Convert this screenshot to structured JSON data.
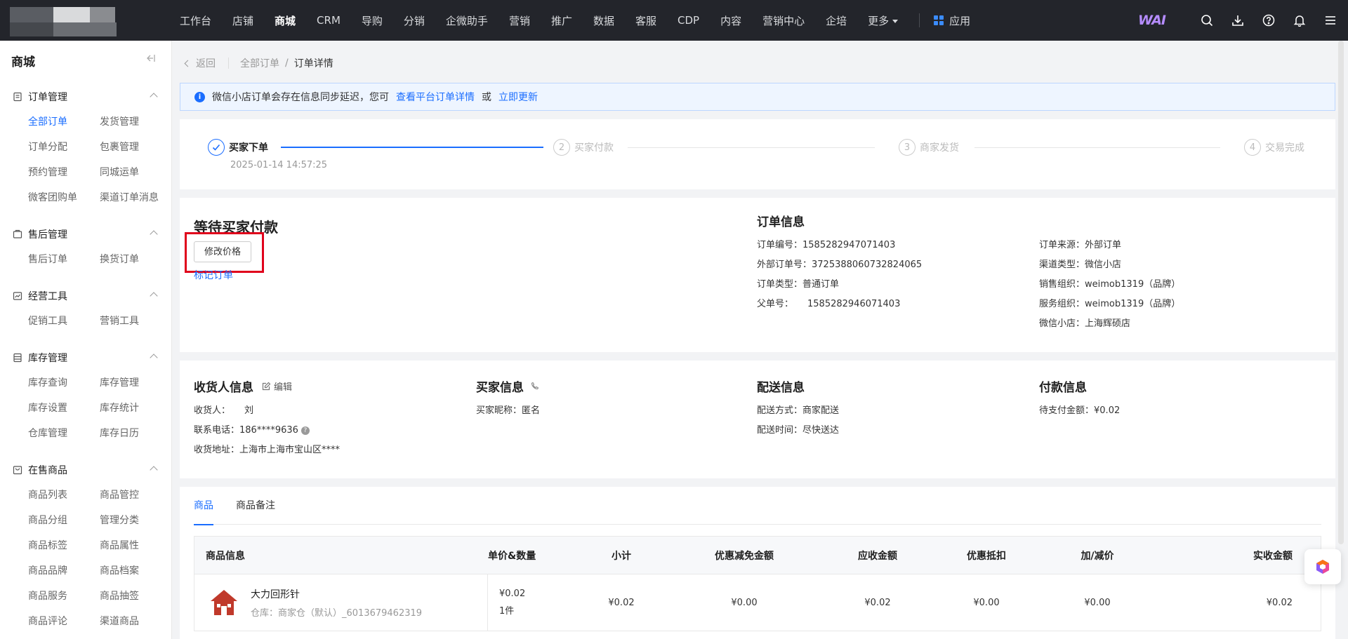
{
  "topbar": {
    "nav": [
      "工作台",
      "店铺",
      "商城",
      "CRM",
      "导购",
      "分销",
      "企微助手",
      "营销",
      "推广",
      "数据",
      "客服",
      "CDP",
      "内容",
      "营销中心",
      "企培"
    ],
    "active": "商城",
    "more": "更多",
    "app": "应用",
    "wai": "WAI",
    "icons": [
      "search-icon",
      "download-icon",
      "help-icon",
      "bell-icon",
      "menu-icon"
    ]
  },
  "sidebar": {
    "title": "商城",
    "groups": [
      {
        "label": "订单管理",
        "icon": "order-icon",
        "items": [
          "全部订单",
          "发货管理",
          "订单分配",
          "包裹管理",
          "预约管理",
          "同城运单",
          "微客团购单",
          "渠道订单消息"
        ]
      },
      {
        "label": "售后管理",
        "icon": "aftersale-icon",
        "items": [
          "售后订单",
          "换货订单"
        ]
      },
      {
        "label": "经营工具",
        "icon": "chart-icon",
        "items": [
          "促销工具",
          "营销工具"
        ]
      },
      {
        "label": "库存管理",
        "icon": "stock-icon",
        "items": [
          "库存查询",
          "库存管理",
          "库存设置",
          "库存统计",
          "仓库管理",
          "库存日历"
        ]
      },
      {
        "label": "在售商品",
        "icon": "goods-icon",
        "items": [
          "商品列表",
          "商品管控",
          "商品分组",
          "管理分类",
          "商品标签",
          "商品属性",
          "商品品牌",
          "商品档案",
          "商品服务",
          "商品抽签",
          "商品评论",
          "渠道商品"
        ]
      }
    ],
    "active_item": "全部订单"
  },
  "breadcrumb": {
    "back": "返回",
    "parent": "全部订单",
    "current": "订单详情"
  },
  "notice": {
    "text": "微信小店订单会存在信息同步延迟，您可",
    "link1": "查看平台订单详情",
    "or": "或",
    "link2": "立即更新"
  },
  "steps": [
    {
      "num": "1",
      "label": "买家下单",
      "done": true
    },
    {
      "num": "2",
      "label": "买家付款",
      "done": false
    },
    {
      "num": "3",
      "label": "商家发货",
      "done": false
    },
    {
      "num": "4",
      "label": "交易完成",
      "done": false
    }
  ],
  "step_time": "2025-01-14 14:57:25",
  "status": {
    "title": "等待买家付款",
    "modify_price": "修改价格",
    "mark_order": "标记订单"
  },
  "order_info": {
    "title": "订单信息",
    "left": [
      {
        "k": "订单编号：",
        "v": "1585282947071403"
      },
      {
        "k": "外部订单号：",
        "v": "3725388060732824065"
      },
      {
        "k": "订单类型：",
        "v": "普通订单"
      },
      {
        "k": "父单号：",
        "v": "1585282946071403"
      }
    ],
    "right": [
      {
        "k": "订单来源：",
        "v": "外部订单"
      },
      {
        "k": "渠道类型：",
        "v": "微信小店"
      },
      {
        "k": "销售组织：",
        "v": "weimob1319（品牌）"
      },
      {
        "k": "服务组织：",
        "v": "weimob1319（品牌）"
      },
      {
        "k": "微信小店：",
        "v": "上海辉硕店"
      }
    ]
  },
  "receiver": {
    "title": "收货人信息",
    "edit": "编辑",
    "name_k": "收货人：",
    "name_v": "刘",
    "phone_k": "联系电话：",
    "phone_v": "186****9636",
    "addr_k": "收货地址：",
    "addr_v": "上海市上海市宝山区****"
  },
  "buyer": {
    "title": "买家信息",
    "nick_k": "买家昵称：",
    "nick_v": "匿名"
  },
  "delivery": {
    "title": "配送信息",
    "mode_k": "配送方式：",
    "mode_v": "商家配送",
    "time_k": "配送时间：",
    "time_v": "尽快送达"
  },
  "payment": {
    "title": "付款信息",
    "due_k": "待支付金额：",
    "due_v": "¥0.02"
  },
  "goods": {
    "tabs": [
      "商品",
      "商品备注"
    ],
    "headers": [
      "商品信息",
      "单价&数量",
      "小计",
      "优惠减免金额",
      "应收金额",
      "优惠抵扣",
      "加/减价",
      "实收金额"
    ],
    "row": {
      "name": "大力回形针",
      "warehouse": "仓库：商家仓（默认）_6013679462319",
      "price": "¥0.02",
      "qty": "1件",
      "subtotal": "¥0.02",
      "discount": "¥0.00",
      "receivable": "¥0.02",
      "deduct": "¥0.00",
      "adjust": "¥0.00",
      "received": "¥0.02"
    }
  }
}
